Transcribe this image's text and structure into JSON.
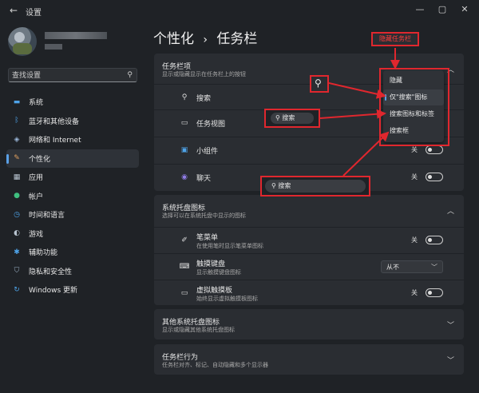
{
  "window": {
    "title": "设置",
    "back": "←",
    "min": "—",
    "max": "▢",
    "close": "✕"
  },
  "sidebar": {
    "search_placeholder": "查找设置",
    "items": [
      {
        "label": "系统",
        "icon": "monitor-icon",
        "glyph": "▬",
        "color": "#4ea3e8"
      },
      {
        "label": "蓝牙和其他设备",
        "icon": "bluetooth-icon",
        "glyph": "ᛒ",
        "color": "#4ea3e8"
      },
      {
        "label": "网络和 Internet",
        "icon": "wifi-icon",
        "glyph": "◈",
        "color": "#9ab6d8"
      },
      {
        "label": "个性化",
        "icon": "brush-icon",
        "glyph": "✎",
        "color": "#e0a060"
      },
      {
        "label": "应用",
        "icon": "apps-icon",
        "glyph": "▦",
        "color": "#b8c4d0"
      },
      {
        "label": "帐户",
        "icon": "account-icon",
        "glyph": "●",
        "color": "#3fbf7f"
      },
      {
        "label": "时间和语言",
        "icon": "globe-clock-icon",
        "glyph": "◷",
        "color": "#4ea3e8"
      },
      {
        "label": "游戏",
        "icon": "gamepad-icon",
        "glyph": "◐",
        "color": "#b8c4d0"
      },
      {
        "label": "辅助功能",
        "icon": "accessibility-icon",
        "glyph": "✱",
        "color": "#4ea3e8"
      },
      {
        "label": "隐私和安全性",
        "icon": "shield-icon",
        "glyph": "⛉",
        "color": "#9ab0c4"
      },
      {
        "label": "Windows 更新",
        "icon": "update-icon",
        "glyph": "↻",
        "color": "#4ea3e8"
      }
    ],
    "active_index": 3
  },
  "main": {
    "breadcrumb_parent": "个性化",
    "breadcrumb_sep": "›",
    "breadcrumb_current": "任务栏",
    "taskbar_items": {
      "title": "任务栏项",
      "subtitle": "显示或隐藏显示在任务栏上的按钮",
      "rows": [
        {
          "label": "搜索",
          "icon": "search-icon"
        },
        {
          "label": "任务视图",
          "icon": "task-view-icon"
        },
        {
          "label": "小组件",
          "icon": "widgets-icon",
          "state": "关"
        },
        {
          "label": "聊天",
          "icon": "chat-icon",
          "state": "关"
        }
      ]
    },
    "tray_icons": {
      "title": "系统托盘图标",
      "subtitle": "选择可以在系统托盘中显示的图标",
      "rows": [
        {
          "label": "笔菜单",
          "sub": "在使用笔时显示笔菜单图标",
          "icon": "pen-icon",
          "state": "关"
        },
        {
          "label": "触摸键盘",
          "sub": "显示触摸键盘图标",
          "icon": "keyboard-icon",
          "dropdown": "从不"
        },
        {
          "label": "虚拟触摸板",
          "sub": "始终显示虚拟触摸板图标",
          "icon": "touchpad-icon",
          "state": "关"
        }
      ]
    },
    "other_tray": {
      "title": "其他系统托盘图标",
      "subtitle": "显示或隐藏其他系统托盘图标"
    },
    "behaviors": {
      "title": "任务栏行为",
      "subtitle": "任务栏对齐、标记、自动隐藏和多个显示器"
    }
  },
  "search_popup": {
    "options": [
      "隐藏",
      "仅\"搜索\"图标",
      "搜索图标和标签",
      "搜索框"
    ],
    "selected_index": 1
  },
  "annotations": {
    "hide_taskbar_label": "隐藏任务栏",
    "demo_search_button": "搜索",
    "demo_search_box": "搜索",
    "accent_red": "#e0272e"
  }
}
